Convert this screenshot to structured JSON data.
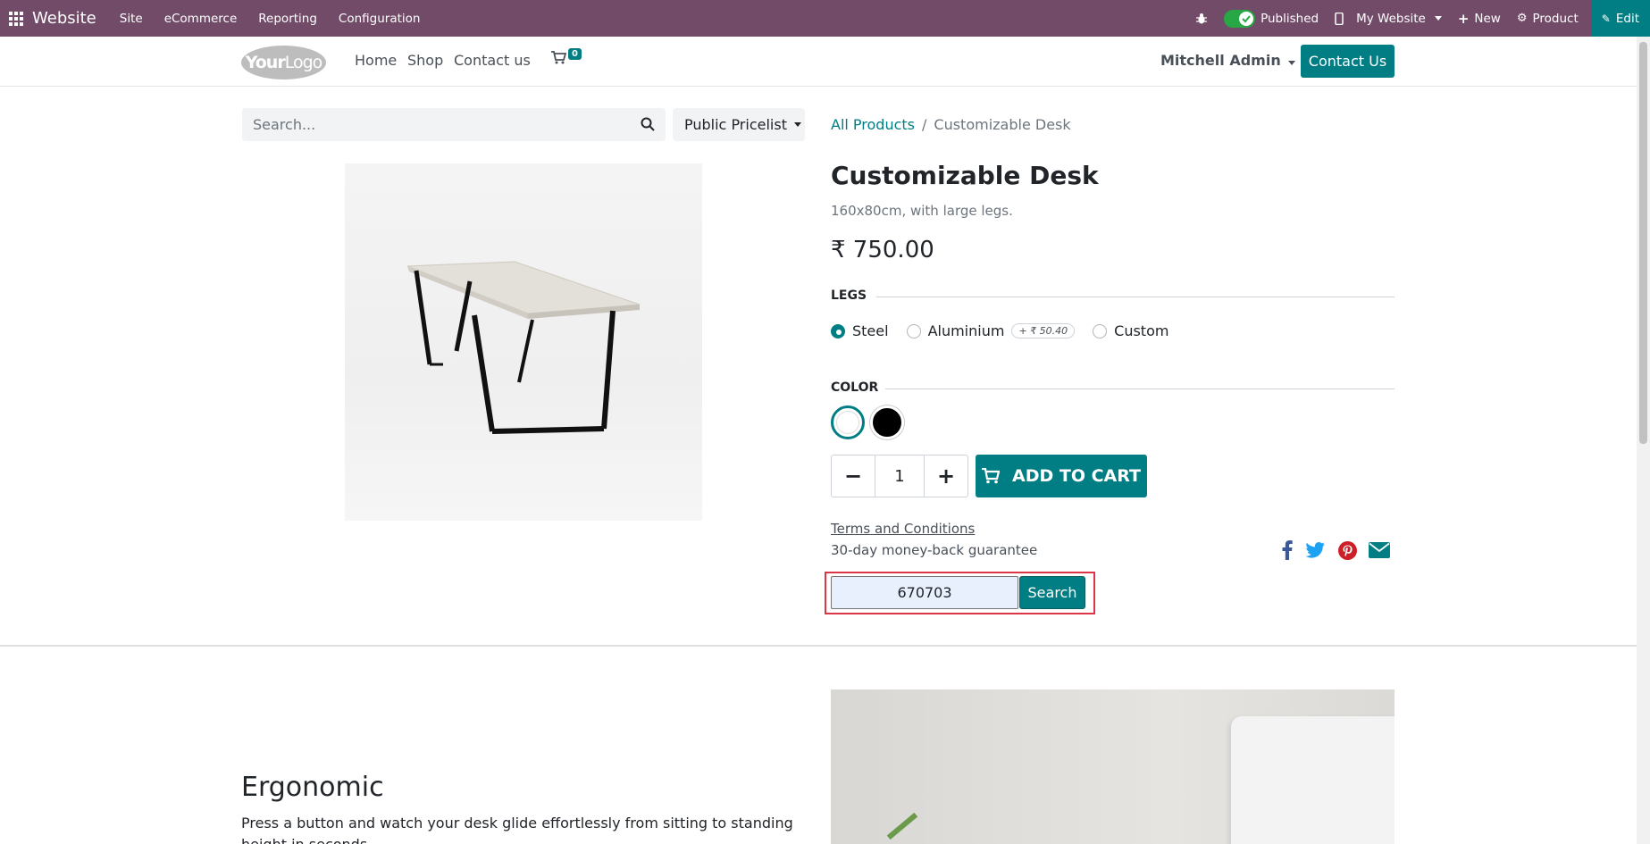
{
  "topbar": {
    "brand": "Website",
    "menus": [
      "Site",
      "eCommerce",
      "Reporting",
      "Configuration"
    ],
    "published_label": "Published",
    "website_label": "My Website",
    "new_label": "New",
    "product_label": "Product",
    "edit_label": "Edit"
  },
  "header": {
    "logo_text_bold": "Your",
    "logo_text": "Logo",
    "nav": [
      "Home",
      "Shop",
      "Contact us"
    ],
    "cart_count": "0",
    "user": "Mitchell Admin",
    "contact_button": "Contact Us"
  },
  "search": {
    "placeholder": "Search...",
    "pricelist": "Public Pricelist"
  },
  "breadcrumb": {
    "root": "All Products",
    "current": "Customizable Desk"
  },
  "product": {
    "title": "Customizable Desk",
    "subtitle": "160x80cm, with large legs.",
    "price": "₹ 750.00",
    "legs_label": "LEGS",
    "legs_options": [
      {
        "label": "Steel",
        "checked": true
      },
      {
        "label": "Aluminium",
        "checked": false,
        "extra": "+ ₹ 50.40"
      },
      {
        "label": "Custom",
        "checked": false
      }
    ],
    "color_label": "COLOR",
    "colors": [
      "#ffffff",
      "#000000"
    ],
    "quantity": "1",
    "add_to_cart": "ADD TO CART",
    "terms": "Terms and Conditions",
    "guarantee": "30-day money-back guarantee",
    "share_icons": [
      "facebook-icon",
      "twitter-icon",
      "pinterest-icon",
      "envelope-icon"
    ]
  },
  "injected": {
    "input_value": "670703",
    "search_button": "Search"
  },
  "lower": {
    "heading": "Ergonomic",
    "text": "Press a button and watch your desk glide effortlessly from sitting to standing height in seconds."
  },
  "colors": {
    "topbar": "#714B67",
    "accent": "#017e84"
  }
}
